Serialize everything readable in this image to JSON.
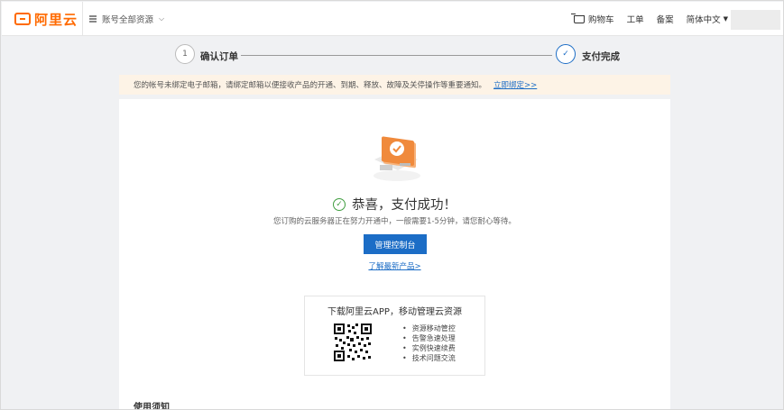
{
  "header": {
    "logo_text": "阿里云",
    "resource_label": "账号全部资源",
    "nav": {
      "cart": "购物车",
      "ticket": "工单",
      "record": "备案",
      "language": "简体中文"
    }
  },
  "steps": [
    {
      "number": "1",
      "label": "确认订单"
    },
    {
      "number": "✓",
      "label": "支付完成"
    }
  ],
  "notice": {
    "text": "您的帐号未绑定电子邮箱，请绑定邮箱以便接收产品的开通、到期、释放、故障及关停操作等重要通知。",
    "link": "立即绑定>>"
  },
  "result": {
    "title": "恭喜，支付成功！",
    "subtitle": "您订购的云服务器正在努力开通中，一般需要1-5分钟，请您耐心等待。",
    "console_button": "管理控制台",
    "products_link": "了解最新产品>"
  },
  "app_promo": {
    "title": "下载阿里云APP，移动管理云资源",
    "features": [
      "资源移动管控",
      "告警急速处理",
      "实例快速续费",
      "技术问题交流"
    ]
  },
  "usage": {
    "title": "使用须知"
  },
  "colors": {
    "brand": "#ff6a00",
    "primary": "#1c6dc6",
    "success": "#3f9d3f",
    "notice_bg": "#fdf3e6"
  }
}
